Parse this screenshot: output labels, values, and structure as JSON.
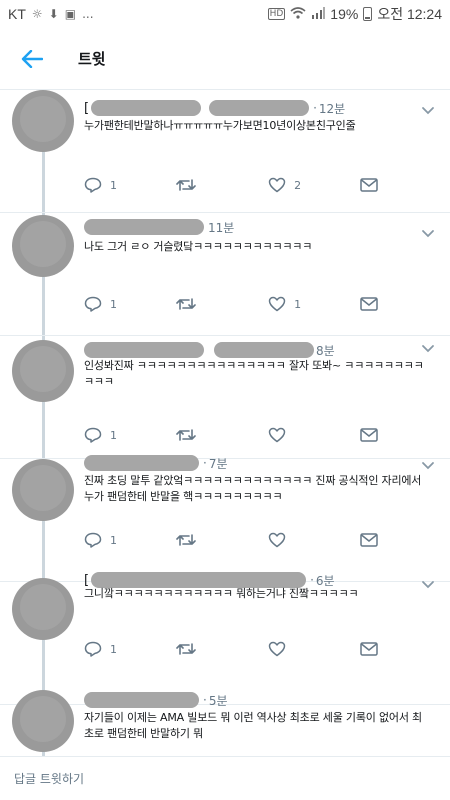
{
  "status_bar": {
    "carrier": "KT",
    "left_icons": [
      "brightness-icon",
      "download-icon",
      "image-icon"
    ],
    "overflow": "...",
    "hd_label": "HD",
    "battery": "19%",
    "time": "오전 12:24"
  },
  "header": {
    "title": "트윗"
  },
  "accent": "#1da1f2",
  "tweets": [
    {
      "time": "12분",
      "prefix": "[",
      "body": "누가팬한테반말하나ㅠㅠㅠㅠㅠ누가보면10년이상본친구인줄",
      "reply_count": "1",
      "retweet_count": "",
      "like_count": "2"
    },
    {
      "time": "11분",
      "prefix": "",
      "body": "나도 그거 ㄹㅇ 거슬렸닼ㅋㅋㅋㅋㅋㅋㅋㅋㅋㅋㅋㅋ",
      "reply_count": "1",
      "retweet_count": "",
      "like_count": "1"
    },
    {
      "time": "8분",
      "prefix": "",
      "body": "인성봐진짜 ㅋㅋㅋㅋㅋㅋㅋㅋㅋㅋㅋㅋㅋㅋㅋ 잘자 또봐~ ㅋㅋㅋㅋㅋㅋㅋㅋㅋㅋㅋ",
      "reply_count": "1",
      "retweet_count": "",
      "like_count": ""
    },
    {
      "time": "7분",
      "prefix": "",
      "body": "진짜 초딩 말투 같았엌ㅋㅋㅋㅋㅋㅋㅋㅋㅋㅋㅋㅋㅋ 진짜 공식적인 자리에서 누가 팬덤한테 반말을 핵ㅋㅋㅋㅋㅋㅋㅋㅋㅋ",
      "reply_count": "1",
      "retweet_count": "",
      "like_count": ""
    },
    {
      "time": "6분",
      "prefix": "[",
      "body": "그니깤ㅋㅋㅋㅋㅋㅋㅋㅋㅋㅋㅋㅋ 뭐하는거냐 진짴ㅋㅋㅋㅋㅋ",
      "reply_count": "1",
      "retweet_count": "",
      "like_count": ""
    },
    {
      "time": "5분",
      "prefix": "",
      "body": "자기들이 이제는 AMA 빌보드 뭐 이런 역사상 최초로 세울 기록이 없어서 최초로 팬덤한테 반말하기 뭐",
      "reply_count": "",
      "retweet_count": "",
      "like_count": ""
    }
  ],
  "reply_bar": {
    "placeholder": "답글 트윗하기"
  }
}
